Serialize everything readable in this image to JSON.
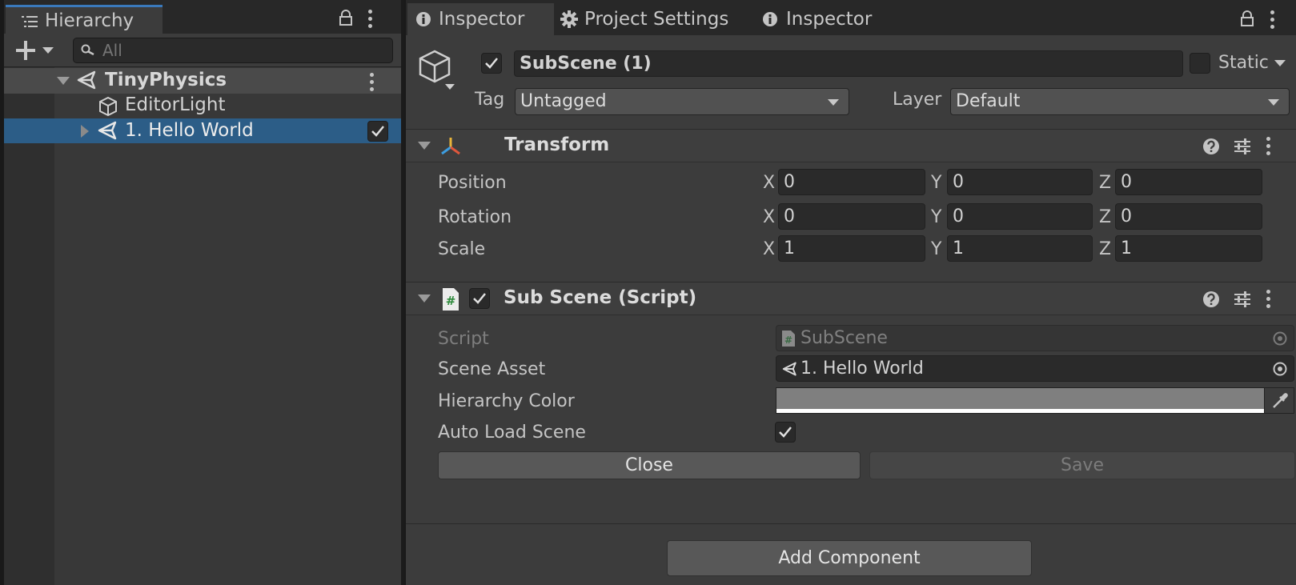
{
  "hierarchy": {
    "tab_label": "Hierarchy",
    "search_placeholder": "All",
    "items": [
      {
        "label": "TinyPhysics"
      },
      {
        "label": "EditorLight"
      },
      {
        "label": "1. Hello World"
      }
    ]
  },
  "inspector": {
    "tabs": [
      {
        "label": "Inspector"
      },
      {
        "label": "Project Settings"
      },
      {
        "label": "Inspector"
      }
    ],
    "object": {
      "name": "SubScene (1)",
      "static_label": "Static",
      "tag_label": "Tag",
      "tag_value": "Untagged",
      "layer_label": "Layer",
      "layer_value": "Default"
    },
    "transform": {
      "title": "Transform",
      "rows": [
        {
          "label": "Position",
          "x": "0",
          "y": "0",
          "z": "0"
        },
        {
          "label": "Rotation",
          "x": "0",
          "y": "0",
          "z": "0"
        },
        {
          "label": "Scale",
          "x": "1",
          "y": "1",
          "z": "1"
        }
      ],
      "axis_x": "X",
      "axis_y": "Y",
      "axis_z": "Z"
    },
    "subscene": {
      "title": "Sub Scene (Script)",
      "script_label": "Script",
      "script_value": "SubScene",
      "scene_asset_label": "Scene Asset",
      "scene_asset_value": "1. Hello World",
      "hierarchy_color_label": "Hierarchy Color",
      "hierarchy_color": "#7f7f7f",
      "auto_load_label": "Auto Load Scene",
      "close_label": "Close",
      "save_label": "Save"
    },
    "add_component_label": "Add Component"
  },
  "colors": {
    "selection": "#2c5d87",
    "accent": "#3a79bb"
  }
}
